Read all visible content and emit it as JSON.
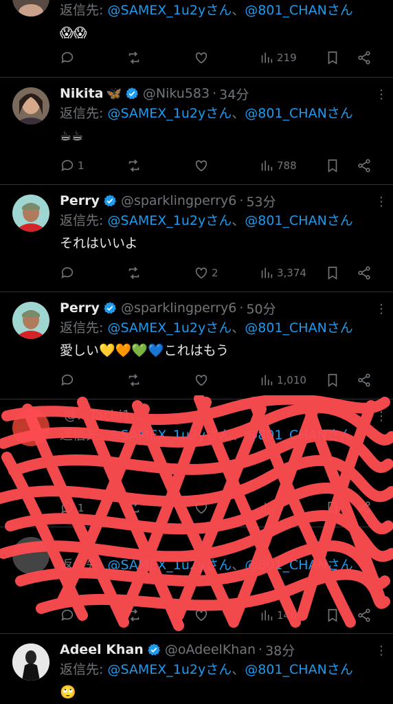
{
  "reply_prefix": "返信先: ",
  "reply_to_1": "@SAMEX_1u2yさん",
  "reply_sep": "、",
  "reply_to_2": "@801_CHANさん",
  "tweets": [
    {
      "text": "😱😱",
      "replies": "",
      "retweets": "",
      "likes": "",
      "views": "219"
    },
    {
      "name": "Nikita",
      "name_emoji": "🦋",
      "handle": "@Niku583",
      "time": "34分",
      "text": "☕☕",
      "replies": "1",
      "retweets": "",
      "likes": "",
      "views": "788"
    },
    {
      "name": "Perry",
      "handle": "@sparklingperry6",
      "time": "53分",
      "text": "それはいいよ",
      "replies": "",
      "retweets": "",
      "likes": "2",
      "views": "3,374"
    },
    {
      "name": "Perry",
      "handle": "@sparklingperry6",
      "time": "50分",
      "text": "愛しい💛🧡💚💙これはもう",
      "replies": "",
      "retweets": "",
      "likes": "",
      "views": "1,010"
    },
    {
      "handle": "@...Tachi1... ",
      "text": "",
      "replies": "1",
      "retweets": "",
      "likes": "",
      "views": ""
    },
    {
      "text": "",
      "replies": "",
      "retweets": "",
      "likes": "",
      "views": "146"
    },
    {
      "name": "Adeel Khan",
      "handle": "@oAdeelKhan",
      "time": "38分",
      "text": "🙄"
    }
  ],
  "icons": {
    "reply": "reply-icon",
    "retweet": "retweet-icon",
    "like": "heart-icon",
    "views": "views-icon",
    "bookmark": "bookmark-icon",
    "share": "share-icon",
    "verified": "verified-badge-icon",
    "more": "more-options-icon"
  },
  "colors": {
    "accent": "#1d9bf0",
    "muted": "#71767b",
    "text": "#e7e9ea",
    "background": "#000000",
    "scribble": "#ff4d52"
  }
}
